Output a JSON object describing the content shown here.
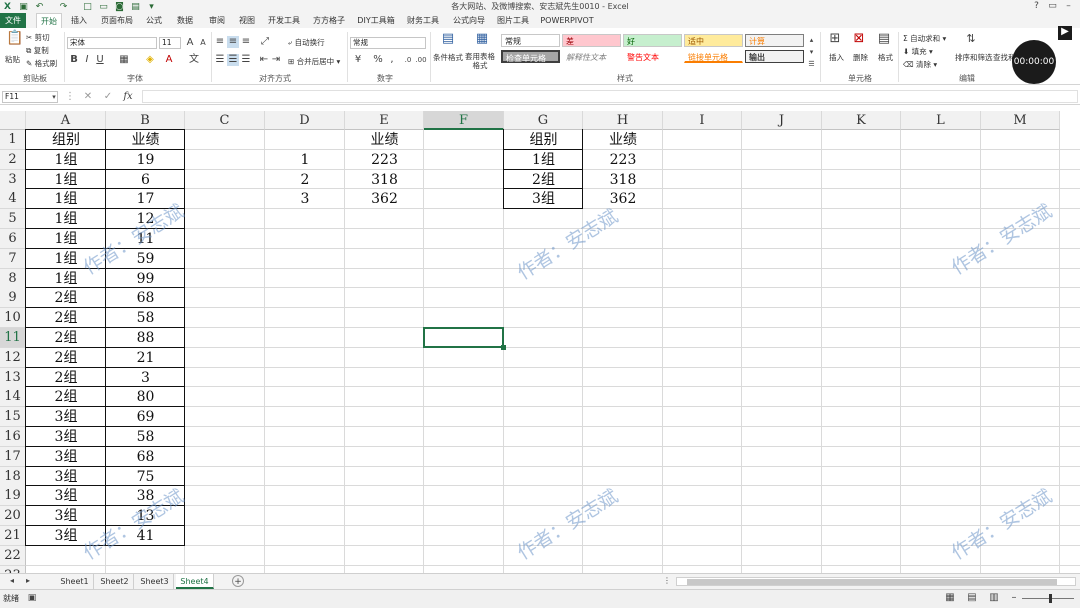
{
  "window_title": "各大网站、及微博搜索、安志斌先生0010 - Excel",
  "tabs": [
    "文件",
    "开始",
    "插入",
    "页面布局",
    "公式",
    "数据",
    "审阅",
    "视图",
    "开发工具",
    "方方格子",
    "DIY工具箱",
    "财务工具",
    "公式向导",
    "图片工具",
    "POWERPIVOT"
  ],
  "ribbon": {
    "clipboard": {
      "paste": "粘贴",
      "cut": "剪切",
      "copy": "复制",
      "format_painter": "格式刷",
      "label": "剪贴板"
    },
    "font": {
      "name": "宋体",
      "size": "11",
      "label": "字体"
    },
    "alignment": {
      "wrap": "自动换行",
      "merge": "合并后居中",
      "label": "对齐方式"
    },
    "number": {
      "format": "常规",
      "label": "数字"
    },
    "styles": {
      "cond_format": "条件格式",
      "table_format": "套用表格格式",
      "label": "样式",
      "cells": [
        {
          "text": "常规",
          "bg": "#ffffff",
          "fg": "#000"
        },
        {
          "text": "差",
          "bg": "#ffc7ce",
          "fg": "#9c0006"
        },
        {
          "text": "好",
          "bg": "#c6efce",
          "fg": "#006100"
        },
        {
          "text": "适中",
          "bg": "#ffeb9c",
          "fg": "#9c5700"
        },
        {
          "text": "计算",
          "bg": "#f2f2f2",
          "fg": "#fa7d00"
        },
        {
          "text": "检查单元格",
          "bg": "#a5a5a5",
          "fg": "#ffffff"
        },
        {
          "text": "解释性文本",
          "bg": "#ffffff",
          "fg": "#7f7f7f"
        },
        {
          "text": "警告文本",
          "bg": "#ffffff",
          "fg": "#ff0000"
        },
        {
          "text": "链接单元格",
          "bg": "#ffffff",
          "fg": "#fa7d00"
        },
        {
          "text": "输出",
          "bg": "#f2f2f2",
          "fg": "#3f3f3f"
        }
      ]
    },
    "cells_grp": {
      "insert": "插入",
      "delete": "删除",
      "format": "格式",
      "label": "单元格"
    },
    "editing": {
      "autosum": "自动求和",
      "fill": "填充",
      "clear": "清除",
      "sort": "排序和筛选",
      "find": "查找和选择",
      "label": "编辑"
    }
  },
  "video_time": "00:00:00",
  "formula_bar": {
    "name_box": "F11",
    "formula": ""
  },
  "columns": [
    "A",
    "B",
    "C",
    "D",
    "E",
    "F",
    "G",
    "H",
    "I",
    "J",
    "K",
    "L",
    "M"
  ],
  "selected_column": "F",
  "selected_row": "11",
  "rows": [
    "1",
    "2",
    "3",
    "4",
    "5",
    "6",
    "7",
    "8",
    "9",
    "10",
    "11",
    "12",
    "13",
    "14",
    "15",
    "16",
    "17",
    "18",
    "19",
    "20",
    "21",
    "22",
    "23"
  ],
  "table_ab": {
    "headers": [
      "组别",
      "业绩"
    ],
    "data": [
      [
        "1组",
        "19"
      ],
      [
        "1组",
        "6"
      ],
      [
        "1组",
        "17"
      ],
      [
        "1组",
        "12"
      ],
      [
        "1组",
        "11"
      ],
      [
        "1组",
        "59"
      ],
      [
        "1组",
        "99"
      ],
      [
        "2组",
        "68"
      ],
      [
        "2组",
        "58"
      ],
      [
        "2组",
        "88"
      ],
      [
        "2组",
        "21"
      ],
      [
        "2组",
        "3"
      ],
      [
        "2组",
        "80"
      ],
      [
        "3组",
        "69"
      ],
      [
        "3组",
        "58"
      ],
      [
        "3组",
        "68"
      ],
      [
        "3组",
        "75"
      ],
      [
        "3组",
        "38"
      ],
      [
        "3组",
        "13"
      ],
      [
        "3组",
        "41"
      ]
    ]
  },
  "table_de": {
    "header": "业绩",
    "data": [
      [
        "1",
        "223"
      ],
      [
        "2",
        "318"
      ],
      [
        "3",
        "362"
      ]
    ]
  },
  "table_gh": {
    "headers": [
      "组别",
      "业绩"
    ],
    "data": [
      [
        "1组",
        "223"
      ],
      [
        "2组",
        "318"
      ],
      [
        "3组",
        "362"
      ]
    ]
  },
  "watermark_text": "作者：安志斌",
  "sheet_tabs": [
    "Sheet1",
    "Sheet2",
    "Sheet3",
    "Sheet4"
  ],
  "active_sheet": "Sheet4",
  "status": "就绪"
}
